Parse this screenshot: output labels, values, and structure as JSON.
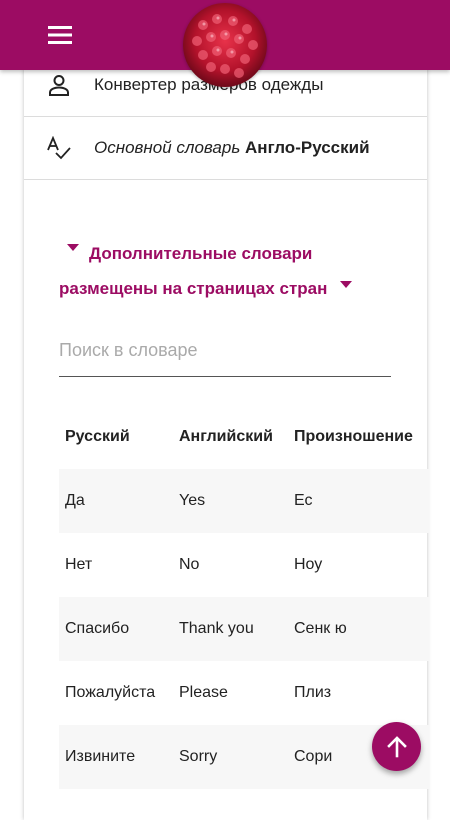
{
  "colors": {
    "accent": "#9c0c63",
    "row_shade": "#f7f7f7"
  },
  "topbar": {
    "menu_icon": "hamburger-menu-icon",
    "logo": "raspberry-logo"
  },
  "menu": {
    "clothes_converter": {
      "icon": "person-icon",
      "label": "Конвертер размеров одежды"
    },
    "main_dictionary": {
      "icon": "spellcheck-icon",
      "label_italic": "Основной словарь",
      "label_bold": "Англо-Русский"
    }
  },
  "extra_dicts": {
    "line1": "Дополнительные словари",
    "line2": "размещены на страницах стран"
  },
  "search": {
    "placeholder": "Поиск в словаре",
    "value": ""
  },
  "table": {
    "columns": [
      "Русский",
      "Английский",
      "Произношение"
    ],
    "rows": [
      [
        "Да",
        "Yes",
        "Ес"
      ],
      [
        "Нет",
        "No",
        "Ноу"
      ],
      [
        "Спасибо",
        "Thank you",
        "Сенк ю"
      ],
      [
        "Пожалуйста",
        "Please",
        "Плиз"
      ],
      [
        "Извините",
        "Sorry",
        "Сори"
      ]
    ]
  },
  "fab": {
    "icon": "arrow-up-icon"
  }
}
